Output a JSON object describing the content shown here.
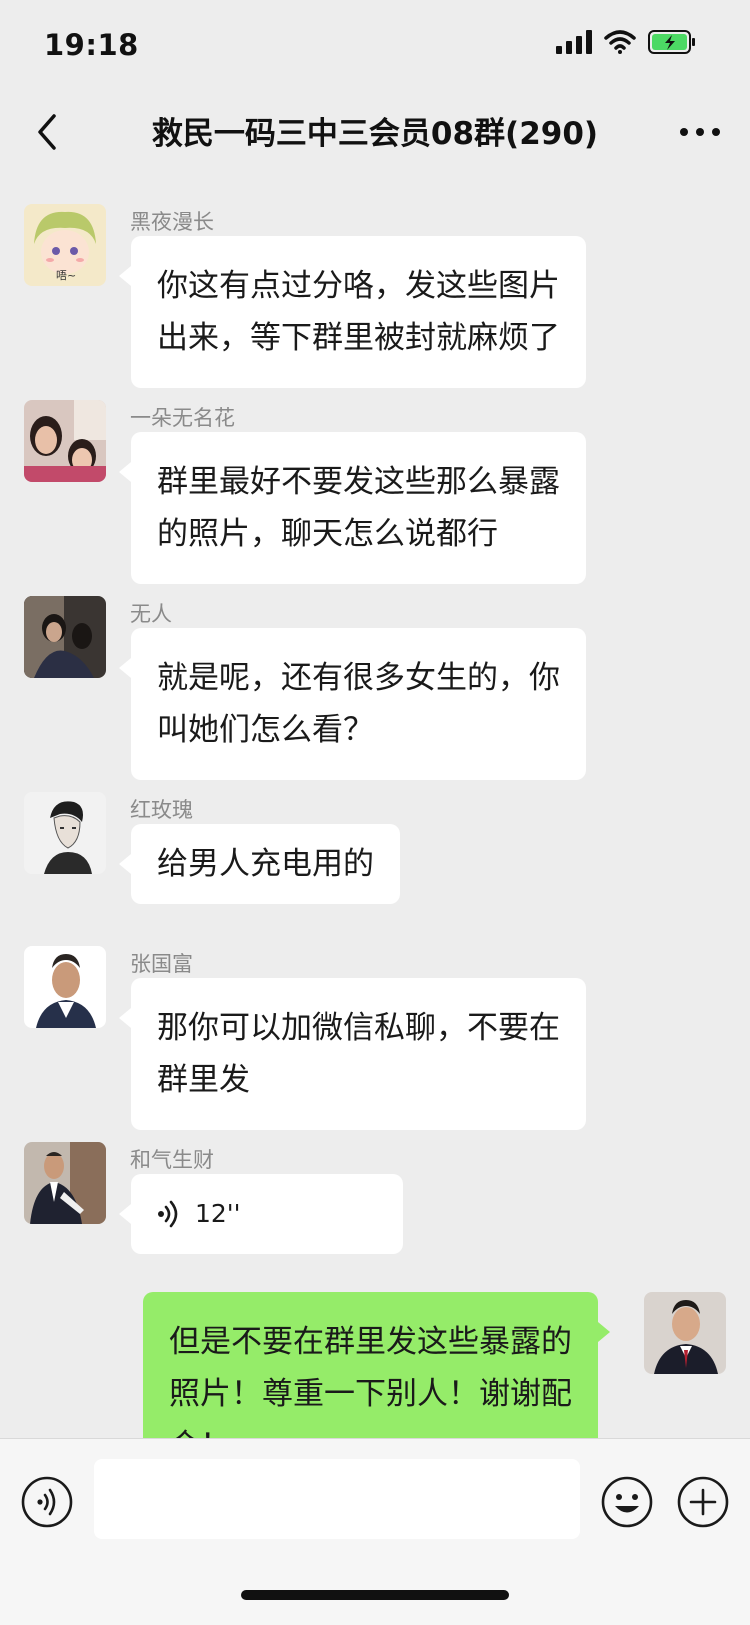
{
  "status_bar": {
    "time": "19:18"
  },
  "header": {
    "title": "救民一码三中三会员08群(290)"
  },
  "messages": [
    {
      "sender": "黑夜漫长",
      "lines": [
        "你这有点过分咯，发这些图片",
        "出来，等下群里被封就麻烦了"
      ],
      "avatar_text": "唔~"
    },
    {
      "sender": "一朵无名花",
      "lines": [
        "群里最好不要发这些那么暴露",
        "的照片，聊天怎么说都行"
      ]
    },
    {
      "sender": "无人",
      "lines": [
        "就是呢，还有很多女生的，你",
        "叫她们怎么看？"
      ]
    },
    {
      "sender": "红玫瑰",
      "lines": [
        "给男人充电用的"
      ]
    },
    {
      "sender": "张国富",
      "lines": [
        "那你可以加微信私聊，不要在",
        "群里发"
      ]
    },
    {
      "sender": "和气生财",
      "voice_duration": "12''"
    },
    {
      "sender": "",
      "mine": true,
      "lines": [
        "但是不要在群里发这些暴露的",
        "照片！尊重一下别人！谢谢配",
        "合！"
      ]
    }
  ],
  "input_bar": {
    "placeholder": ""
  },
  "icons": {
    "back": "chevron-left-icon",
    "more": "more-icon",
    "voice": "voice-icon",
    "emoji": "emoji-icon",
    "plus": "plus-icon"
  },
  "colors": {
    "background": "#ededed",
    "bubble_other": "#ffffff",
    "bubble_mine": "#95ec69",
    "battery": "#4cd964"
  }
}
